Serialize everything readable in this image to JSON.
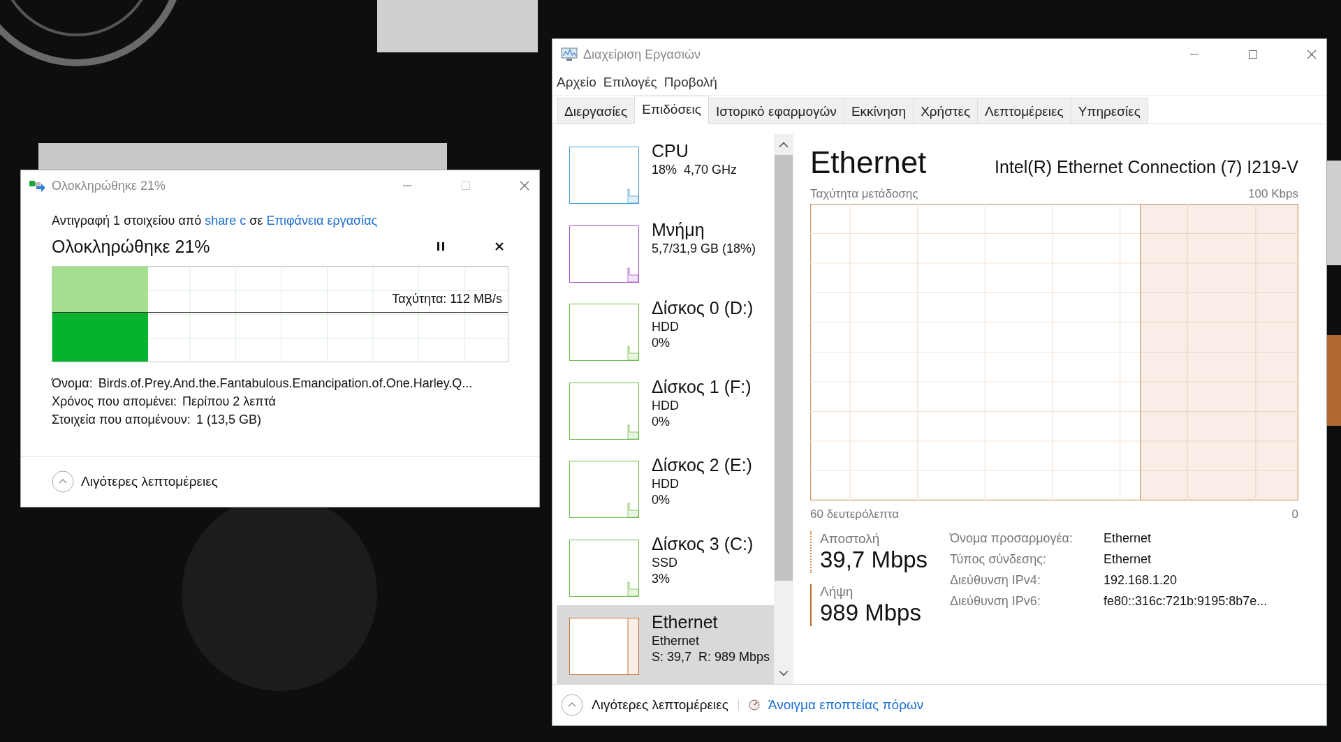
{
  "copy_dialog": {
    "title": "Ολοκληρώθηκε 21%",
    "description": {
      "prefix": "Αντιγραφή 1 στοιχείου από",
      "source": "share c",
      "middle": "σε",
      "destination": "Επιφάνεια εργασίας"
    },
    "status": "Ολοκληρώθηκε 21%",
    "progress": {
      "level": 0.21,
      "speed": "Ταχύτητα: 112 MB/s"
    },
    "details": [
      {
        "label": "Όνομα:",
        "value": "Birds.of.Prey.And.the.Fantabulous.Emancipation.of.One.Harley.Q..."
      },
      {
        "label": "Χρόνος που απομένει:",
        "value": "Περίπου 2 λεπτά"
      },
      {
        "label": "Στοιχεία που απομένουν:",
        "value": "1 (13,5 GB)"
      }
    ],
    "toggle": "Λιγότερες λεπτομέρειες"
  },
  "task_manager": {
    "title": "Διαχείριση Εργασιών",
    "menu": [
      "Αρχείο",
      "Επιλογές",
      "Προβολή"
    ],
    "tabs": [
      {
        "label": "Διεργασίες",
        "selected": false
      },
      {
        "label": "Επιδόσεις",
        "selected": true
      },
      {
        "label": "Ιστορικό εφαρμογών",
        "selected": false
      },
      {
        "label": "Εκκίνηση",
        "selected": false
      },
      {
        "label": "Χρήστες",
        "selected": false
      },
      {
        "label": "Λεπτομέρειες",
        "selected": false
      },
      {
        "label": "Υπηρεσίες",
        "selected": false
      }
    ],
    "resources": [
      {
        "name": "CPU",
        "lines": [
          "18%  4,70 GHz"
        ],
        "color": "#4a9fd8",
        "kind": "usage",
        "selected": false
      },
      {
        "name": "Μνήμη",
        "lines": [
          "5,7/31,9 GB (18%)"
        ],
        "color": "#a64fc8",
        "kind": "usage",
        "selected": false
      },
      {
        "name": "Δίσκος 0 (D:)",
        "lines": [
          "HDD",
          "0%"
        ],
        "color": "#6fbf4a",
        "kind": "usage",
        "selected": false
      },
      {
        "name": "Δίσκος 1 (F:)",
        "lines": [
          "HDD",
          "0%"
        ],
        "color": "#6fbf4a",
        "kind": "usage",
        "selected": false
      },
      {
        "name": "Δίσκος 2 (E:)",
        "lines": [
          "HDD",
          "0%"
        ],
        "color": "#6fbf4a",
        "kind": "usage",
        "selected": false
      },
      {
        "name": "Δίσκος 3 (C:)",
        "lines": [
          "SSD",
          "3%"
        ],
        "color": "#6fbf4a",
        "kind": "usage",
        "selected": false
      },
      {
        "name": "Ethernet",
        "lines": [
          "Ethernet",
          "S: 39,7  R: 989 Mbps"
        ],
        "color": "#c8763a",
        "kind": "network",
        "selected": true
      }
    ],
    "detail": {
      "title": "Ethernet",
      "adapter": "Intel(R) Ethernet Connection (7) I219-V",
      "graph_label": "Ταχύτητα μετάδοσης",
      "graph_max": "100 Kbps",
      "graph_span": "60 δευτερόλεπτα",
      "graph_min": "0",
      "send": {
        "label": "Αποστολή",
        "value": "39,7 Mbps"
      },
      "receive": {
        "label": "Λήψη",
        "value": "989 Mbps"
      },
      "properties": [
        {
          "label": "Όνομα προσαρμογέα:",
          "value": "Ethernet"
        },
        {
          "label": "Τύπος σύνδεσης:",
          "value": "Ethernet"
        },
        {
          "label": "Διεύθυνση IPv4:",
          "value": "192.168.1.20"
        },
        {
          "label": "Διεύθυνση IPv6:",
          "value": "fe80::316c:721b:9195:8b7e..."
        }
      ]
    },
    "footer": {
      "toggle": "Λιγότερες λεπτομέρειες",
      "link": "Άνοιγμα εποπτείας πόρων"
    }
  }
}
